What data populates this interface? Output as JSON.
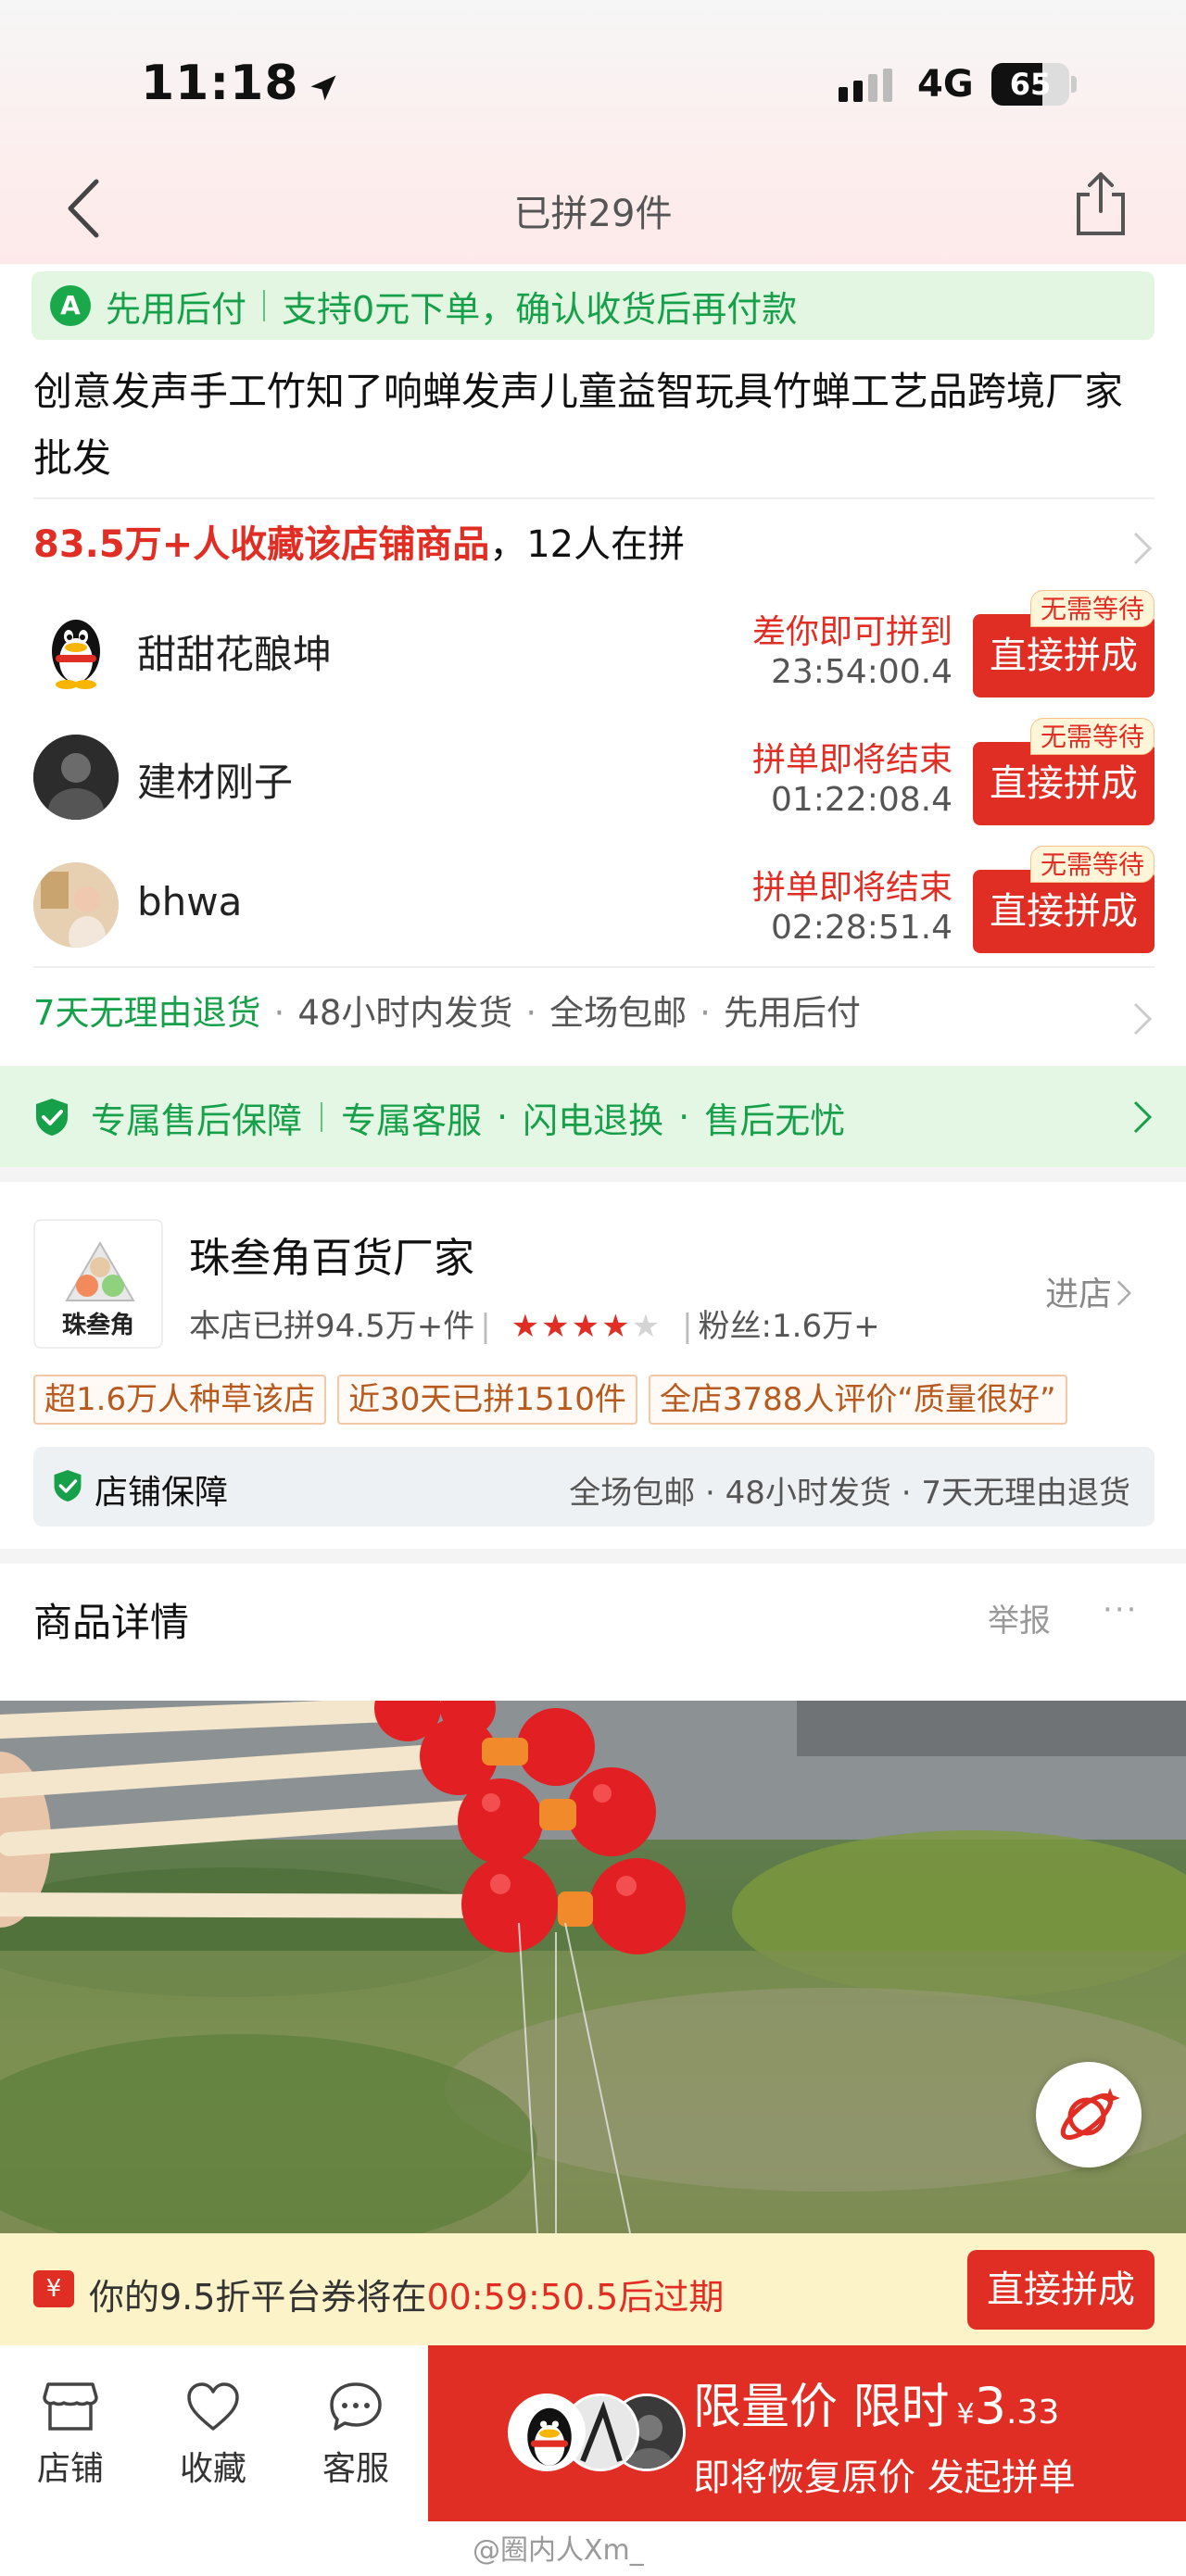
{
  "status_bar": {
    "time": "11:18",
    "network": "4G",
    "battery": "65"
  },
  "nav": {
    "title": "已拼29件"
  },
  "pay_banner": {
    "label": "先用后付",
    "text": "支持0元下单，确认收货后再付款"
  },
  "product": {
    "title": "创意发声手工竹知了响蝉发声儿童益智玩具竹蝉工艺品跨境厂家批发"
  },
  "collect": {
    "highlight": "83.5万+人收藏该店铺商品",
    "rest": "，12人在拼"
  },
  "groups": [
    {
      "name": "甜甜花酿坤",
      "status": "差你即可拼到",
      "timer": "23:54:00.4",
      "button": "直接拼成",
      "badge": "无需等待"
    },
    {
      "name": "建材刚子",
      "status": "拼单即将结束",
      "timer": "01:22:08.4",
      "button": "直接拼成",
      "badge": "无需等待"
    },
    {
      "name": "bhwa",
      "status": "拼单即将结束",
      "timer": "02:28:51.4",
      "button": "直接拼成",
      "badge": "无需等待"
    }
  ],
  "service": {
    "first": "7天无理由退货",
    "items": [
      "48小时内发货",
      "全场包邮",
      "先用后付"
    ]
  },
  "guard": {
    "title": "专属售后保障",
    "items": [
      "专属客服",
      "闪电退换",
      "售后无忧"
    ]
  },
  "shop": {
    "logo_text": "珠叁角",
    "name": "珠叁角百货厂家",
    "sold": "本店已拼94.5万+件",
    "rating_stars": 4,
    "fans": "粉丝:1.6万+",
    "enter": "进店",
    "tags": [
      "超1.6万人种草该店",
      "近30天已拼1510件",
      "全店3788人评价“质量很好”"
    ],
    "guarantee_label": "店铺保障",
    "guarantee_items": "全场包邮 · 48小时发货 · 7天无理由退货"
  },
  "detail": {
    "title": "商品详情",
    "report": "举报",
    "more": "···"
  },
  "coupon": {
    "prefix": "你的9.5折平台券将在",
    "time": "00:59:50.5后过期",
    "button": "直接拼成",
    "icon": "yen-coupon-icon"
  },
  "bottom_tabs": [
    {
      "label": "店铺",
      "icon": "store-icon"
    },
    {
      "label": "收藏",
      "icon": "heart-icon"
    },
    {
      "label": "客服",
      "icon": "chat-icon"
    }
  ],
  "buy": {
    "line1": "限量价 限时",
    "currency": "¥",
    "price_int": "3",
    "price_dec": ".33",
    "line2": "即将恢复原价 发起拼单"
  },
  "watermark": "@圈内人Xm_",
  "colors": {
    "brand_red": "#e02e24",
    "green": "#17a04a",
    "coupon_bg": "#fdf3c9"
  }
}
